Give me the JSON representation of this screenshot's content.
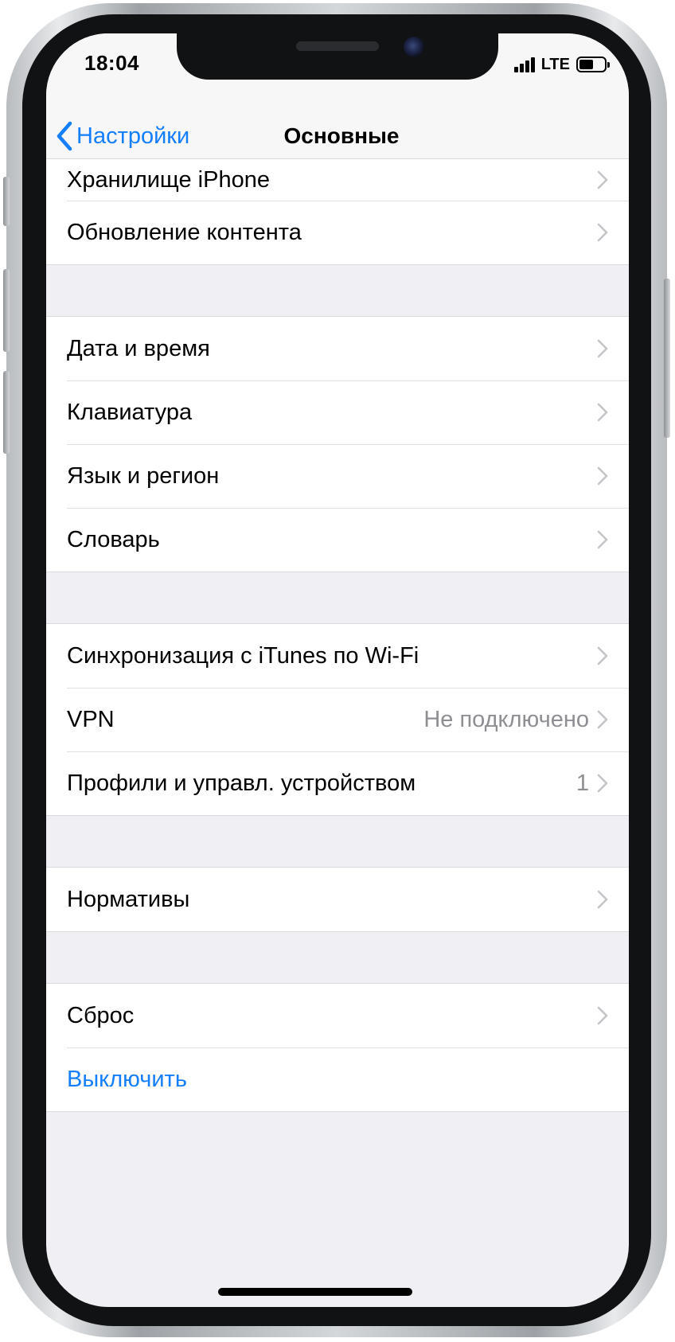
{
  "status_bar": {
    "time": "18:04",
    "network": "LTE",
    "signal_bars": 4,
    "battery_level": 0.55
  },
  "nav": {
    "back_label": "Настройки",
    "title": "Основные"
  },
  "groups": [
    {
      "rows": [
        {
          "label": "Хранилище iPhone",
          "value": "",
          "chevron": true
        },
        {
          "label": "Обновление контента",
          "value": "",
          "chevron": true
        }
      ]
    },
    {
      "rows": [
        {
          "label": "Дата и время",
          "value": "",
          "chevron": true
        },
        {
          "label": "Клавиатура",
          "value": "",
          "chevron": true
        },
        {
          "label": "Язык и регион",
          "value": "",
          "chevron": true
        },
        {
          "label": "Словарь",
          "value": "",
          "chevron": true
        }
      ]
    },
    {
      "rows": [
        {
          "label": "Синхронизация с iTunes по Wi-Fi",
          "value": "",
          "chevron": true
        },
        {
          "label": "VPN",
          "value": "Не подключено",
          "chevron": true
        },
        {
          "label": "Профили и управл. устройством",
          "value": "1",
          "chevron": true
        }
      ]
    },
    {
      "rows": [
        {
          "label": "Нормативы",
          "value": "",
          "chevron": true
        }
      ]
    },
    {
      "rows": [
        {
          "label": "Сброс",
          "value": "",
          "chevron": true
        },
        {
          "label": "Выключить",
          "value": "",
          "chevron": false
        }
      ]
    }
  ],
  "colors": {
    "accent": "#147efb",
    "background": "#efeff4",
    "secondary_text": "#8e8e93"
  },
  "icons": {
    "back": "chevron-left-icon",
    "disclosure": "chevron-right-icon"
  }
}
